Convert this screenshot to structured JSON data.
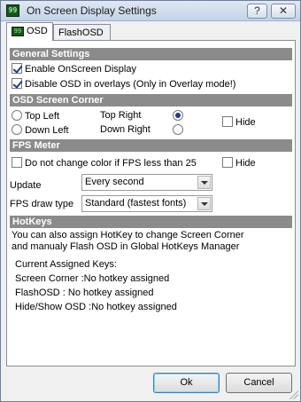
{
  "window": {
    "title": "On Screen Display Settings",
    "help_glyph": "?",
    "close_glyph": "✕",
    "icon_label": "99"
  },
  "tabs": [
    {
      "label": "OSD",
      "icon_label": "99",
      "active": true
    },
    {
      "label": "FlashOSD",
      "active": false
    }
  ],
  "general": {
    "heading": "General Settings",
    "enable_osd": {
      "label": "Enable OnScreen Display",
      "checked": true
    },
    "disable_overlays": {
      "label": "Disable OSD in overlays (Only in Overlay mode!)",
      "checked": true
    }
  },
  "corner": {
    "heading": "OSD Screen Corner",
    "top_left": {
      "label": "Top Left",
      "selected": false
    },
    "top_right": {
      "label": "Top Right",
      "selected": true
    },
    "down_left": {
      "label": "Down Left",
      "selected": false
    },
    "down_right": {
      "label": "Down Right",
      "selected": false
    },
    "hide": {
      "label": "Hide",
      "checked": false
    }
  },
  "fps": {
    "heading": "FPS Meter",
    "no_color_change": {
      "label": "Do not change color if FPS less than 25",
      "checked": false
    },
    "hide": {
      "label": "Hide",
      "checked": false
    },
    "update_label": "Update",
    "update_value": "Every second",
    "draw_type_label": "FPS draw type",
    "draw_type_value": "Standard (fastest fonts)"
  },
  "hotkeys": {
    "heading": "HotKeys",
    "info_line1": "You can also assign HotKey to change Screen Corner",
    "info_line2": "and manualy Flash OSD in Global HotKeys Manager",
    "assigned_title": "Current Assigned Keys:",
    "screen_corner": "Screen Corner :No hotkey assigned",
    "flash_osd": "FlashOSD : No hotkey assigned",
    "hide_show": "Hide/Show OSD :No hotkey assigned"
  },
  "buttons": {
    "ok": "Ok",
    "cancel": "Cancel"
  }
}
